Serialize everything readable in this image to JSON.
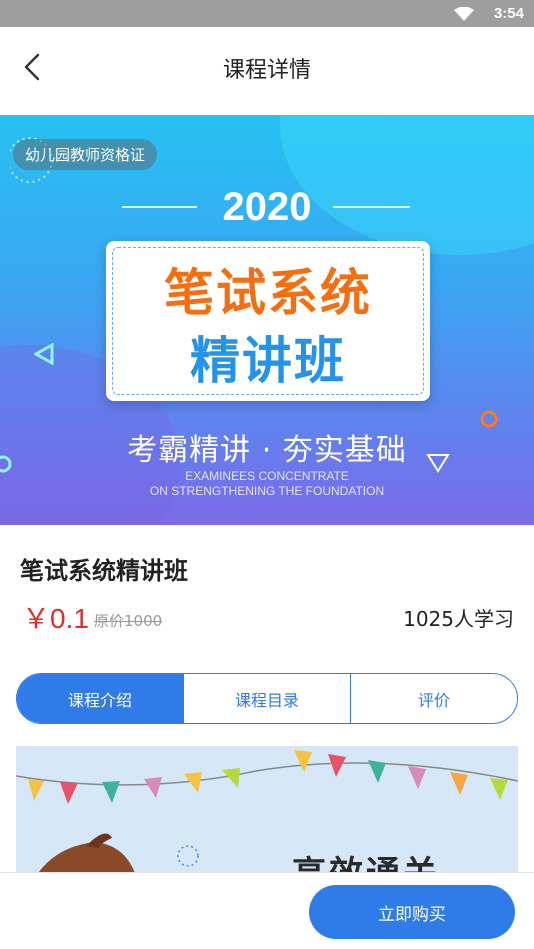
{
  "status_bar": {
    "time": "3:54",
    "wifi_icon": "wifi-icon"
  },
  "header": {
    "title": "课程详情",
    "back_icon": "chevron-left-icon"
  },
  "banner": {
    "tag": "幼儿园教师资格证",
    "year": "2020",
    "card_line1": "笔试系统",
    "card_line2": "精讲班",
    "slogan": "考霸精讲 · 夯实基础",
    "slogan_en_line1": "EXAMINEES CONCENTRATE",
    "slogan_en_line2": "ON STRENGTHENING THE FOUNDATION"
  },
  "course": {
    "name": "笔试系统精讲班",
    "price": "￥0.1",
    "original_price": "原价1000",
    "learners": "1025人学习"
  },
  "tabs": [
    {
      "label": "课程介绍",
      "active": true
    },
    {
      "label": "课程目录",
      "active": false
    },
    {
      "label": "评价",
      "active": false
    }
  ],
  "intro_preview": {
    "text": "高效通关"
  },
  "footer": {
    "buy_label": "立即购买"
  },
  "colors": {
    "accent": "#2f7be8",
    "price": "#e02e2e",
    "card_orange": "#f46f12",
    "card_blue": "#2493e8"
  }
}
